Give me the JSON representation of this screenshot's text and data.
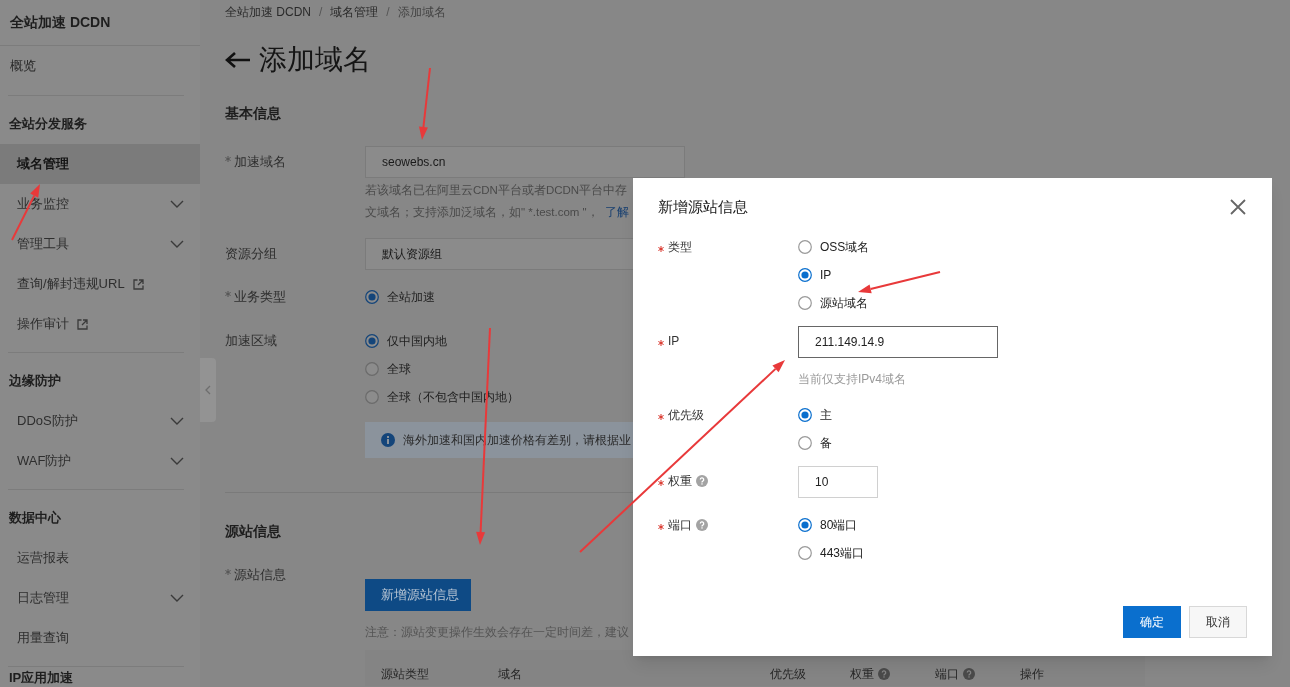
{
  "sidebar": {
    "title": "全站加速 DCDN",
    "items": [
      {
        "kind": "link",
        "label": "概览"
      },
      {
        "kind": "group",
        "label": "全站分发服务",
        "children": [
          {
            "kind": "plain",
            "label": "域名管理",
            "selected": true
          },
          {
            "kind": "expandable",
            "label": "业务监控",
            "selected": false
          },
          {
            "kind": "expandable",
            "label": "管理工具",
            "selected": false
          },
          {
            "kind": "external",
            "label": "查询/解封违规URL",
            "selected": false
          },
          {
            "kind": "external",
            "label": "操作审计",
            "selected": false
          }
        ]
      },
      {
        "kind": "group",
        "label": "边缘防护",
        "children": [
          {
            "kind": "expandable",
            "label": "DDoS防护",
            "selected": false
          },
          {
            "kind": "expandable",
            "label": "WAF防护",
            "selected": false
          }
        ]
      },
      {
        "kind": "group",
        "label": "数据中心",
        "children": [
          {
            "kind": "plain",
            "label": "运营报表",
            "selected": false
          },
          {
            "kind": "expandable",
            "label": "日志管理",
            "selected": false
          },
          {
            "kind": "plain",
            "label": "用量查询",
            "selected": false
          }
        ]
      },
      {
        "kind": "group",
        "label": "IP应用加速"
      }
    ]
  },
  "breadcrumb": {
    "separator": "/",
    "items": [
      "全站加速 DCDN",
      "域名管理",
      "添加域名"
    ]
  },
  "title": "添加域名",
  "basic_info": {
    "heading": "基本信息",
    "fields": [
      {
        "kind": "input",
        "label": "加速域名",
        "required": true,
        "value": "seowebs.cn",
        "help": [
          "若该域名已在阿里云CDN平台或者DCDN平台中存",
          "文域名；支持添加泛域名，如\" *.test.com \"，"
        ],
        "help_link": "了解"
      },
      {
        "kind": "select",
        "label": "资源分组",
        "required": false,
        "value": "默认资源组"
      },
      {
        "kind": "radio",
        "label": "业务类型",
        "required": true,
        "options": [
          {
            "label": "全站加速",
            "selected": true
          }
        ]
      },
      {
        "kind": "radio",
        "label": "加速区域",
        "required": false,
        "options": [
          {
            "label": "仅中国内地",
            "selected": true
          },
          {
            "label": "全球",
            "selected": false
          },
          {
            "label": "全球（不包含中国内地）",
            "selected": false
          }
        ],
        "notice": "海外加速和国内加速价格有差别，请根据业"
      }
    ]
  },
  "origin_info": {
    "heading": "源站信息",
    "label": "源站信息",
    "required": true,
    "button": "新增源站信息",
    "note": "注意：源站变更操作生效会存在一定时间差，建议",
    "columns": [
      {
        "label": "源站类型",
        "help": false
      },
      {
        "label": "域名",
        "help": false
      },
      {
        "label": "优先级",
        "help": false
      },
      {
        "label": "权重",
        "help": true
      },
      {
        "label": "端口",
        "help": true
      },
      {
        "label": "操作",
        "help": false
      }
    ]
  },
  "dialog": {
    "title": "新增源站信息",
    "fields": [
      {
        "kind": "radio",
        "label": "类型",
        "required": true,
        "help_icon": false,
        "options": [
          {
            "label": "OSS域名",
            "selected": false
          },
          {
            "label": "IP",
            "selected": true
          },
          {
            "label": "源站域名",
            "selected": false
          }
        ]
      },
      {
        "kind": "input",
        "label": "IP",
        "required": true,
        "help_icon": false,
        "value": "211.149.14.9",
        "hint": "当前仅支持IPv4域名"
      },
      {
        "kind": "radio",
        "label": "优先级",
        "required": true,
        "help_icon": false,
        "options": [
          {
            "label": "主",
            "selected": true
          },
          {
            "label": "备",
            "selected": false
          }
        ]
      },
      {
        "kind": "small-input",
        "label": "权重",
        "required": true,
        "help_icon": true,
        "value": "10"
      },
      {
        "kind": "radio",
        "label": "端口",
        "required": true,
        "help_icon": true,
        "options": [
          {
            "label": "80端口",
            "selected": true
          },
          {
            "label": "443端口",
            "selected": false
          }
        ]
      }
    ],
    "buttons": [
      {
        "label": "确定",
        "kind": "primary"
      },
      {
        "label": "取消",
        "kind": "secondary"
      }
    ]
  }
}
